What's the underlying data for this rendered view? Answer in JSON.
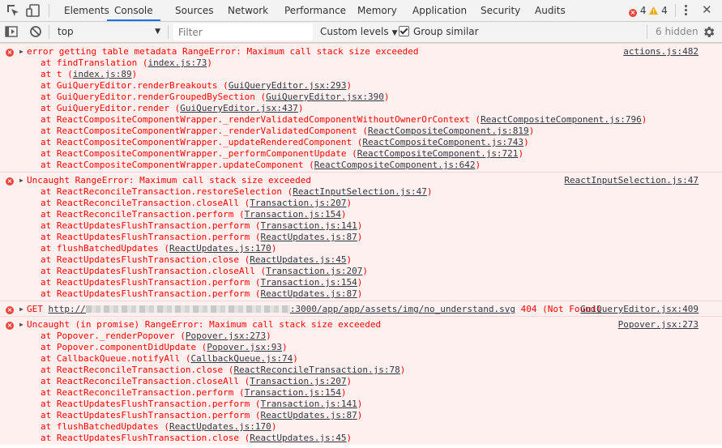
{
  "tabs": [
    "Elements",
    "Console",
    "Sources",
    "Network",
    "Performance",
    "Memory",
    "Application",
    "Security",
    "Audits"
  ],
  "active_tab": "Console",
  "counters": {
    "errors": "4",
    "warnings": "4"
  },
  "toolbar": {
    "context": "top",
    "filter_placeholder": "Filter",
    "levels": "Custom levels",
    "group_similar": "Group similar",
    "hidden": "6 hidden"
  },
  "messages": [
    {
      "text": "error getting table metadata RangeError: Maximum call stack size exceeded",
      "source": "actions.js:482",
      "frames": [
        {
          "fn": "findTranslation",
          "loc": "index.js:73"
        },
        {
          "fn": "t",
          "loc": "index.js:89"
        },
        {
          "fn": "GuiQueryEditor.renderBreakouts",
          "loc": "GuiQueryEditor.jsx:293"
        },
        {
          "fn": "GuiQueryEditor.renderGroupedBySection",
          "loc": "GuiQueryEditor.jsx:390"
        },
        {
          "fn": "GuiQueryEditor.render",
          "loc": "GuiQueryEditor.jsx:437"
        },
        {
          "fn": "ReactCompositeComponentWrapper._renderValidatedComponentWithoutOwnerOrContext",
          "loc": "ReactCompositeComponent.js:796"
        },
        {
          "fn": "ReactCompositeComponentWrapper._renderValidatedComponent",
          "loc": "ReactCompositeComponent.js:819"
        },
        {
          "fn": "ReactCompositeComponentWrapper._updateRenderedComponent",
          "loc": "ReactCompositeComponent.js:743"
        },
        {
          "fn": "ReactCompositeComponentWrapper._performComponentUpdate",
          "loc": "ReactCompositeComponent.js:721"
        },
        {
          "fn": "ReactCompositeComponentWrapper.updateComponent",
          "loc": "ReactCompositeComponent.js:642"
        }
      ]
    },
    {
      "text": "Uncaught RangeError: Maximum call stack size exceeded",
      "source": "ReactInputSelection.js:47",
      "frames": [
        {
          "fn": "ReactReconcileTransaction.restoreSelection",
          "loc": "ReactInputSelection.js:47"
        },
        {
          "fn": "ReactReconcileTransaction.closeAll",
          "loc": "Transaction.js:207"
        },
        {
          "fn": "ReactReconcileTransaction.perform",
          "loc": "Transaction.js:154"
        },
        {
          "fn": "ReactUpdatesFlushTransaction.perform",
          "loc": "Transaction.js:141"
        },
        {
          "fn": "ReactUpdatesFlushTransaction.perform",
          "loc": "ReactUpdates.js:87"
        },
        {
          "fn": "flushBatchedUpdates",
          "loc": "ReactUpdates.js:170"
        },
        {
          "fn": "ReactUpdatesFlushTransaction.close",
          "loc": "ReactUpdates.js:45"
        },
        {
          "fn": "ReactUpdatesFlushTransaction.closeAll",
          "loc": "Transaction.js:207"
        },
        {
          "fn": "ReactUpdatesFlushTransaction.perform",
          "loc": "Transaction.js:154"
        },
        {
          "fn": "ReactUpdatesFlushTransaction.perform",
          "loc": "ReactUpdates.js:87"
        }
      ]
    },
    {
      "get_prefix": "GET",
      "url_start": "http://",
      "url_end": ":3000/app/app/assets/img/no_understand.svg",
      "status": "404 (Not Found)",
      "source": "GuiQueryEditor.jsx:409"
    },
    {
      "text": "Uncaught (in promise) RangeError: Maximum call stack size exceeded",
      "source": "Popover.jsx:273",
      "frames": [
        {
          "fn": "Popover._renderPopover",
          "loc": "Popover.jsx:273"
        },
        {
          "fn": "Popover.componentDidUpdate",
          "loc": "Popover.jsx:93"
        },
        {
          "fn": "CallbackQueue.notifyAll",
          "loc": "CallbackQueue.js:74"
        },
        {
          "fn": "ReactReconcileTransaction.close",
          "loc": "ReactReconcileTransaction.js:78"
        },
        {
          "fn": "ReactReconcileTransaction.closeAll",
          "loc": "Transaction.js:207"
        },
        {
          "fn": "ReactReconcileTransaction.perform",
          "loc": "Transaction.js:154"
        },
        {
          "fn": "ReactUpdatesFlushTransaction.perform",
          "loc": "Transaction.js:141"
        },
        {
          "fn": "ReactUpdatesFlushTransaction.perform",
          "loc": "ReactUpdates.js:87"
        },
        {
          "fn": "flushBatchedUpdates",
          "loc": "ReactUpdates.js:170"
        },
        {
          "fn": "ReactUpdatesFlushTransaction.close",
          "loc": "ReactUpdates.js:45"
        }
      ]
    }
  ]
}
